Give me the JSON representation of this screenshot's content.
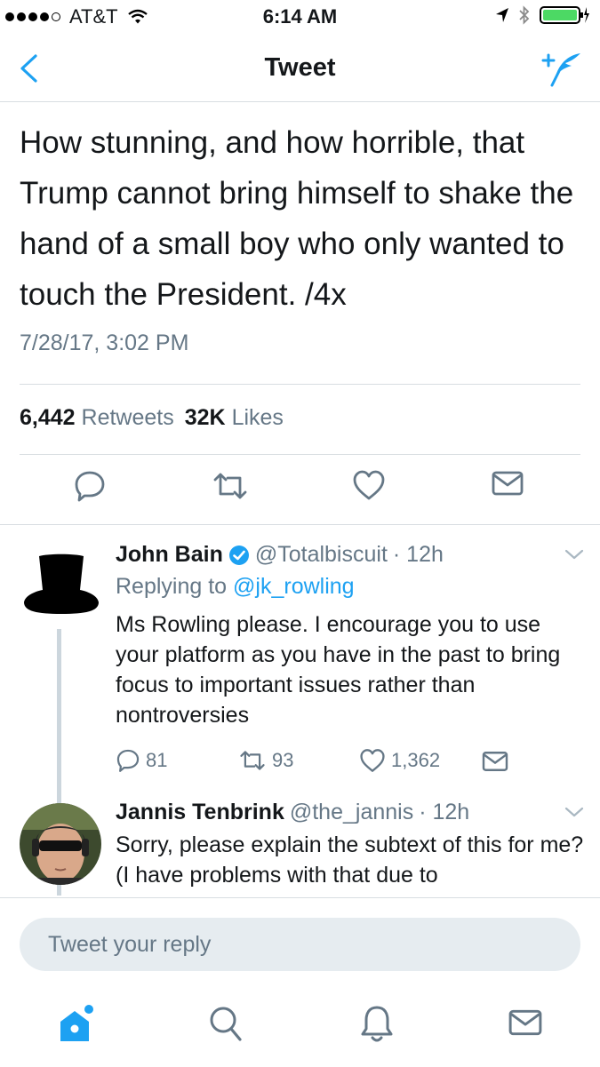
{
  "status_bar": {
    "carrier": "AT&T",
    "time": "6:14 AM"
  },
  "nav": {
    "title": "Tweet"
  },
  "tweet": {
    "text": "How stunning, and how horrible, that Trump cannot bring himself to shake the hand of a small boy who only wanted to touch the President. /4x",
    "date": "7/28/17, 3:02 PM",
    "retweets": "6,442",
    "retweets_label": "Retweets",
    "likes": "32K",
    "likes_label": "Likes"
  },
  "replies": [
    {
      "name": "John Bain",
      "handle": "@Totalbiscuit",
      "time": "· 12h",
      "replying_prefix": "Replying to",
      "replying_to": "@jk_rowling",
      "text": "Ms Rowling please. I encourage you to use your platform as you have in the past to bring focus to important issues rather than nontroversies",
      "reply_count": "81",
      "retweet_count": "93",
      "like_count": "1,362"
    },
    {
      "name": "Jannis Tenbrink",
      "handle": "@the_jannis",
      "time": "· 12h",
      "text": "Sorry, please explain the subtext of this for me? (I have problems with that due to"
    }
  ],
  "composer": {
    "placeholder": "Tweet your reply"
  },
  "colors": {
    "accent": "#1da1f2",
    "muted": "#657786",
    "border": "#d8dde1"
  },
  "icons": [
    "back-chevron-icon",
    "compose-tweet-icon",
    "reply-icon",
    "retweet-icon",
    "like-icon",
    "message-icon",
    "home-icon",
    "search-icon",
    "notifications-icon"
  ]
}
